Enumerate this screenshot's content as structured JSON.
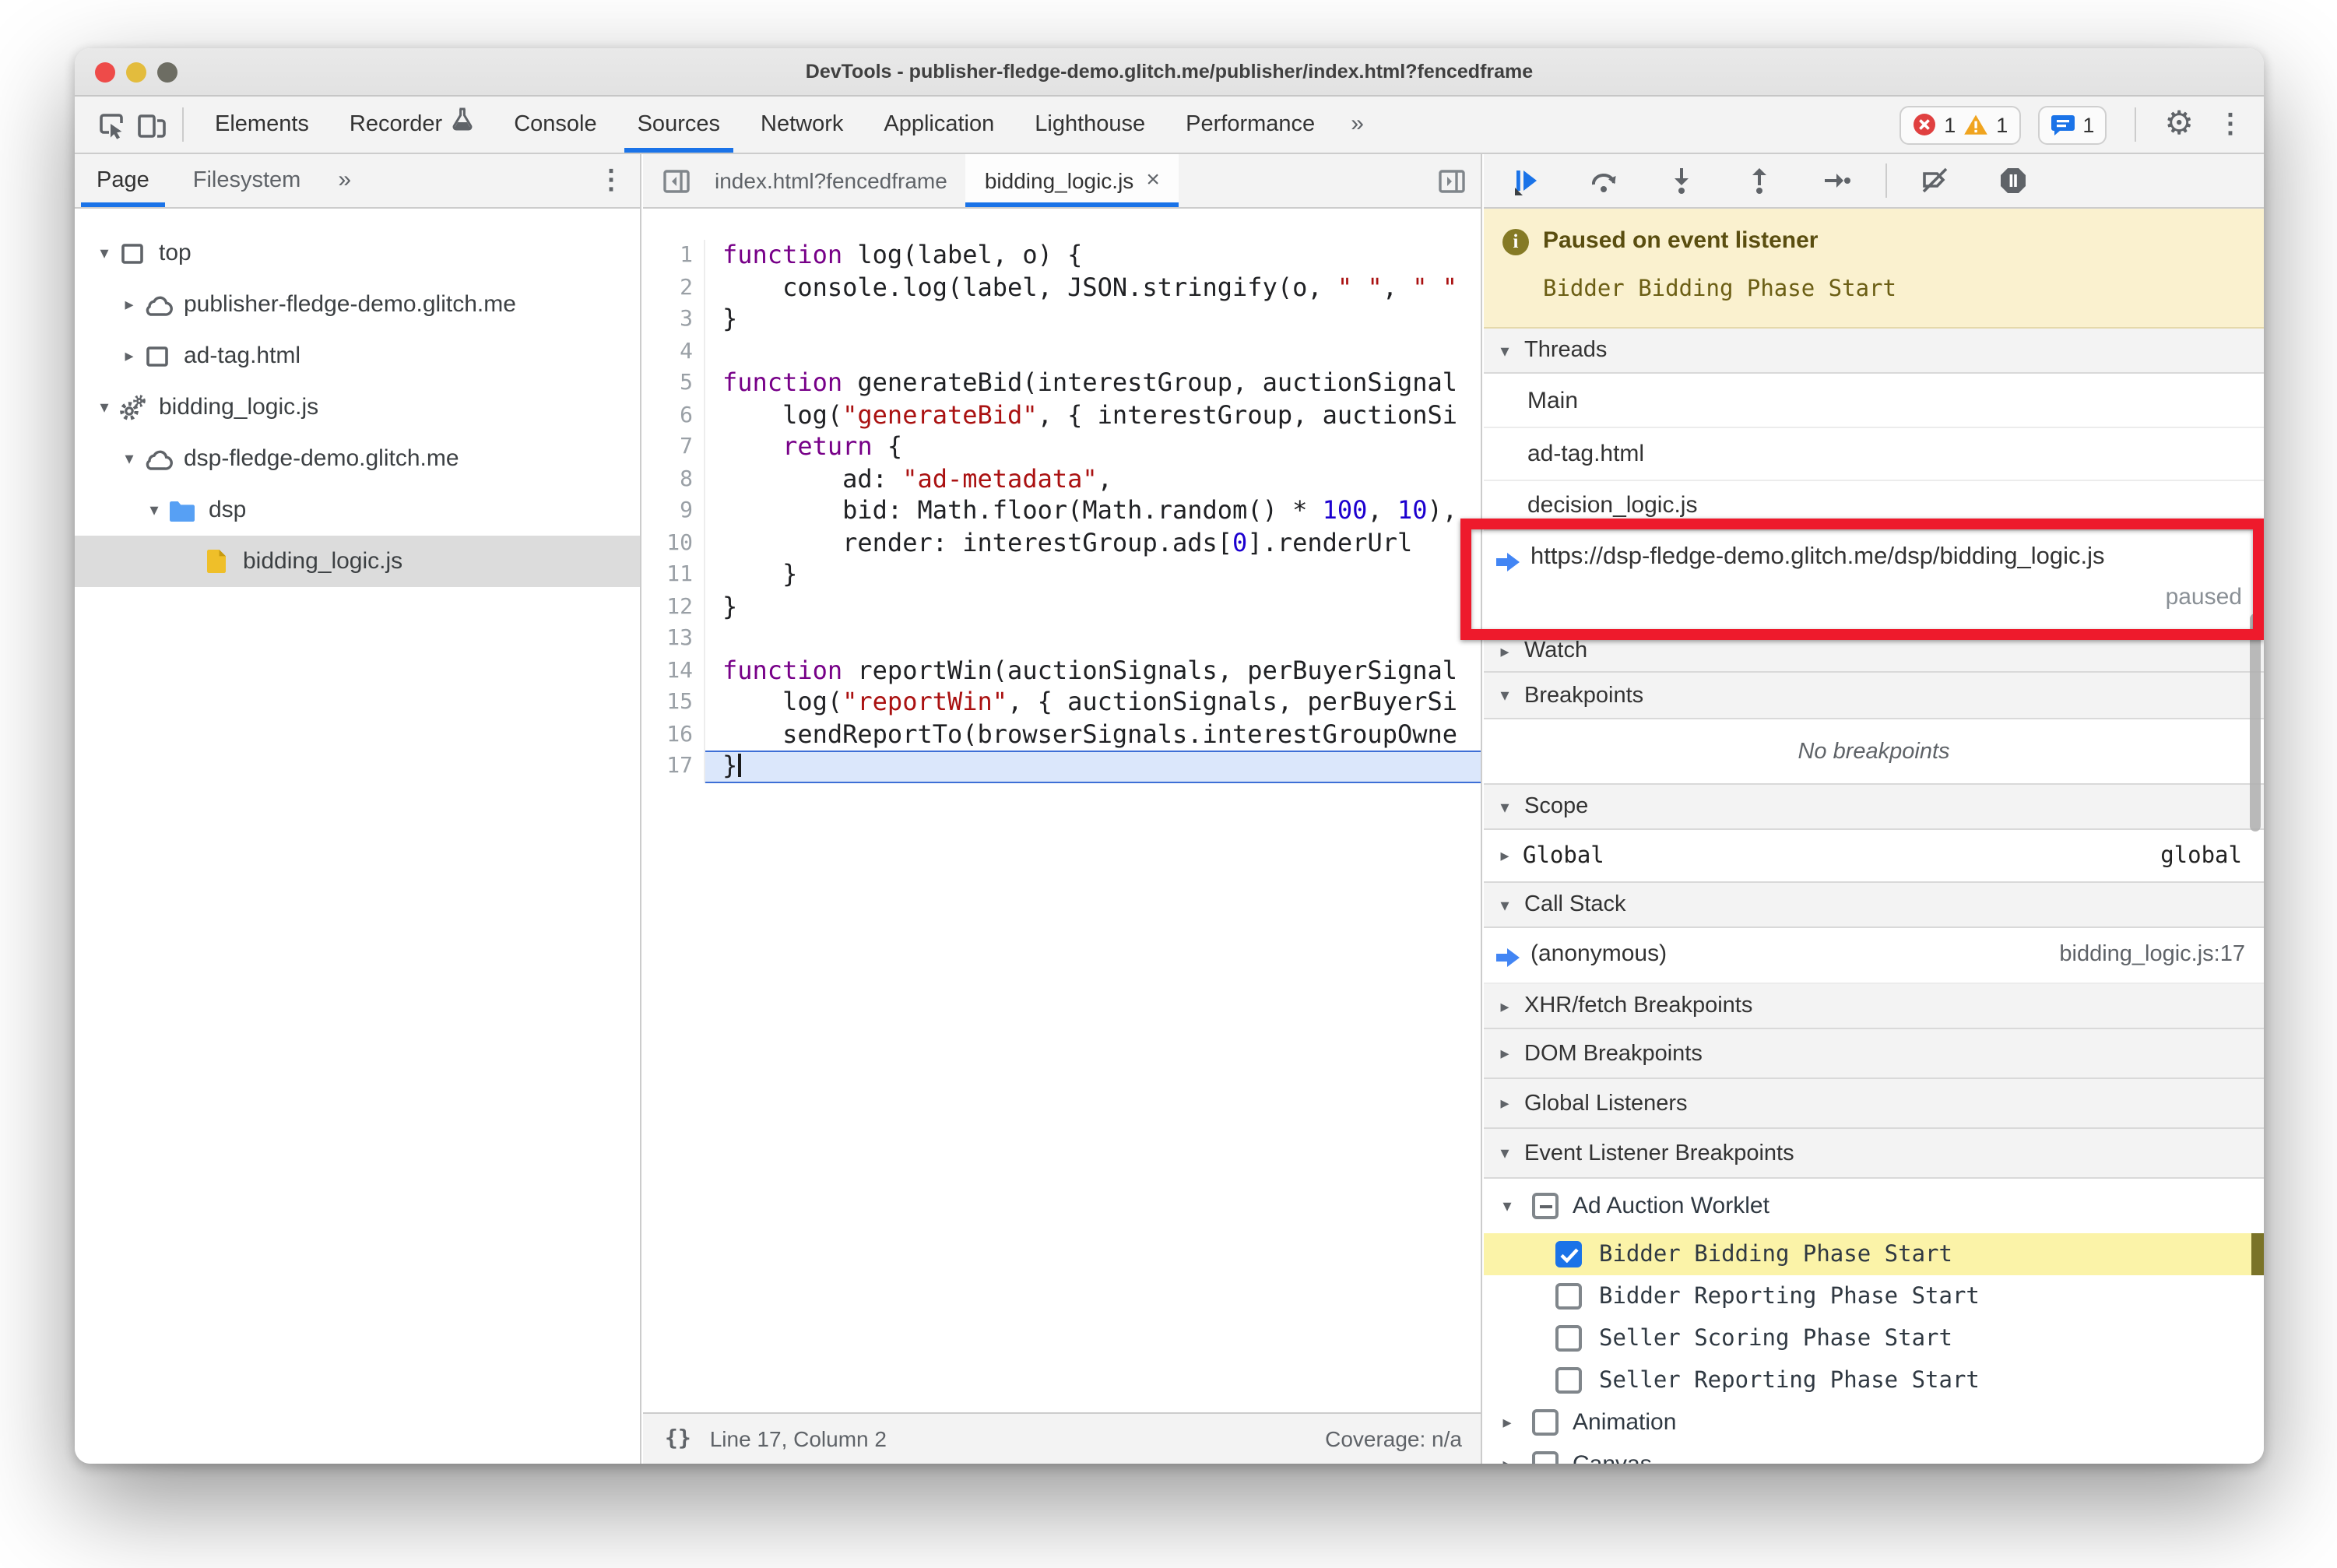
{
  "window": {
    "title": "DevTools - publisher-fledge-demo.glitch.me/publisher/index.html?fencedframe"
  },
  "toolbar": {
    "tabs": [
      "Elements",
      "Recorder",
      "Console",
      "Sources",
      "Network",
      "Application",
      "Lighthouse",
      "Performance"
    ],
    "active_tab": "Sources",
    "more_tabs_label": "»",
    "error_count": "1",
    "warning_count": "1",
    "issues_count": "1"
  },
  "sidebar": {
    "tabs": [
      "Page",
      "Filesystem"
    ],
    "active_tab": "Page",
    "more_label": "»",
    "tree": [
      {
        "label": "top",
        "icon": "frame",
        "depth": 0,
        "expanded": true
      },
      {
        "label": "publisher-fledge-demo.glitch.me",
        "icon": "cloud",
        "depth": 1,
        "expanded": false
      },
      {
        "label": "ad-tag.html",
        "icon": "frame",
        "depth": 1,
        "expanded": false
      },
      {
        "label": "bidding_logic.js",
        "icon": "worklet",
        "depth": 0,
        "expanded": true
      },
      {
        "label": "dsp-fledge-demo.glitch.me",
        "icon": "cloud",
        "depth": 1,
        "expanded": true
      },
      {
        "label": "dsp",
        "icon": "folder",
        "depth": 2,
        "expanded": true
      },
      {
        "label": "bidding_logic.js",
        "icon": "file",
        "depth": 3,
        "selected": true
      }
    ]
  },
  "editor": {
    "tabs": [
      {
        "label": "index.html?fencedframe",
        "active": false
      },
      {
        "label": "bidding_logic.js",
        "active": true,
        "close_label": "×"
      }
    ],
    "code": [
      {
        "num": "1",
        "tokens": [
          [
            "k",
            "function"
          ],
          [
            "p",
            " log(label, o) {"
          ]
        ]
      },
      {
        "num": "2",
        "tokens": [
          [
            "p",
            "    console.log(label, JSON.stringify(o, "
          ],
          [
            "s",
            "\" \""
          ],
          [
            "p",
            ", "
          ],
          [
            "s",
            "\" \""
          ]
        ]
      },
      {
        "num": "3",
        "tokens": [
          [
            "p",
            "}"
          ]
        ]
      },
      {
        "num": "4",
        "tokens": []
      },
      {
        "num": "5",
        "tokens": [
          [
            "k",
            "function"
          ],
          [
            "p",
            " generateBid(interestGroup, auctionSignal"
          ]
        ]
      },
      {
        "num": "6",
        "tokens": [
          [
            "p",
            "    log("
          ],
          [
            "s",
            "\"generateBid\""
          ],
          [
            "p",
            ", { interestGroup, auctionSi"
          ]
        ]
      },
      {
        "num": "7",
        "tokens": [
          [
            "p",
            "    "
          ],
          [
            "k",
            "return"
          ],
          [
            "p",
            " {"
          ]
        ]
      },
      {
        "num": "8",
        "tokens": [
          [
            "p",
            "        ad: "
          ],
          [
            "s",
            "\"ad-metadata\""
          ],
          [
            "p",
            ","
          ]
        ]
      },
      {
        "num": "9",
        "tokens": [
          [
            "p",
            "        bid: Math.floor(Math.random() * "
          ],
          [
            "n",
            "100"
          ],
          [
            "p",
            ", "
          ],
          [
            "n",
            "10"
          ],
          [
            "p",
            "),"
          ]
        ]
      },
      {
        "num": "10",
        "tokens": [
          [
            "p",
            "        render: interestGroup.ads["
          ],
          [
            "n",
            "0"
          ],
          [
            "p",
            "].renderUrl"
          ]
        ]
      },
      {
        "num": "11",
        "tokens": [
          [
            "p",
            "    }"
          ]
        ]
      },
      {
        "num": "12",
        "tokens": [
          [
            "p",
            "}"
          ]
        ]
      },
      {
        "num": "13",
        "tokens": []
      },
      {
        "num": "14",
        "tokens": [
          [
            "k",
            "function"
          ],
          [
            "p",
            " reportWin(auctionSignals, perBuyerSignal"
          ]
        ]
      },
      {
        "num": "15",
        "tokens": [
          [
            "p",
            "    log("
          ],
          [
            "s",
            "\"reportWin\""
          ],
          [
            "p",
            ", { auctionSignals, perBuyerSi"
          ]
        ]
      },
      {
        "num": "16",
        "tokens": [
          [
            "p",
            "    sendReportTo(browserSignals.interestGroupOwne"
          ]
        ]
      },
      {
        "num": "17",
        "tokens": [
          [
            "p",
            "}"
          ]
        ],
        "paused": true
      }
    ],
    "status": {
      "braces": "{}",
      "line_col": "Line 17, Column 2",
      "coverage": "Coverage: n/a"
    }
  },
  "debugger": {
    "paused_banner": {
      "title": "Paused on event listener",
      "detail": "Bidder Bidding Phase Start"
    },
    "threads": {
      "label": "Threads",
      "expanded": true,
      "items": [
        {
          "label": "Main"
        },
        {
          "label": "ad-tag.html"
        },
        {
          "label": "decision_logic.js"
        },
        {
          "label": "https://dsp-fledge-demo.glitch.me/dsp/bidding_logic.js",
          "status": "paused",
          "current": true
        }
      ]
    },
    "watch": {
      "label": "Watch",
      "expanded": false
    },
    "breakpoints": {
      "label": "Breakpoints",
      "expanded": true,
      "empty_message": "No breakpoints"
    },
    "scope": {
      "label": "Scope",
      "expanded": true,
      "entries": [
        {
          "label": "Global",
          "value": "global",
          "expanded": false
        }
      ]
    },
    "call_stack": {
      "label": "Call Stack",
      "expanded": true,
      "frames": [
        {
          "label": "(anonymous)",
          "location": "bidding_logic.js:17",
          "current": true
        }
      ]
    },
    "xhr_fetch_breakpoints": {
      "label": "XHR/fetch Breakpoints",
      "expanded": false
    },
    "dom_breakpoints": {
      "label": "DOM Breakpoints",
      "expanded": false
    },
    "global_listeners": {
      "label": "Global Listeners",
      "expanded": false
    },
    "event_listener_breakpoints": {
      "label": "Event Listener Breakpoints",
      "expanded": true
    },
    "event_listener_groups": [
      {
        "label": "Ad Auction Worklet",
        "expanded": true,
        "checkbox": "indeterminate",
        "children": [
          {
            "label": "Bidder Bidding Phase Start",
            "checkbox": "checked",
            "highlighted": true
          },
          {
            "label": "Bidder Reporting Phase Start",
            "checkbox": "unchecked"
          },
          {
            "label": "Seller Scoring Phase Start",
            "checkbox": "unchecked"
          },
          {
            "label": "Seller Reporting Phase Start",
            "checkbox": "unchecked"
          }
        ]
      },
      {
        "label": "Animation",
        "expanded": false,
        "checkbox": "unchecked",
        "children": []
      },
      {
        "label": "Canvas",
        "expanded": false,
        "checkbox": "unchecked",
        "children": []
      }
    ]
  },
  "colors": {
    "accent_blue": "#1a73e8",
    "annotation_red": "#ee1a2c",
    "paused_banner_bg": "#faf1cf",
    "highlight_row_yellow": "#fbf3a8",
    "paused_line_blue": "#dbe7fb",
    "keyword_purple": "#770088",
    "string_red": "#aa1111",
    "number_blue": "#1c00cf"
  }
}
